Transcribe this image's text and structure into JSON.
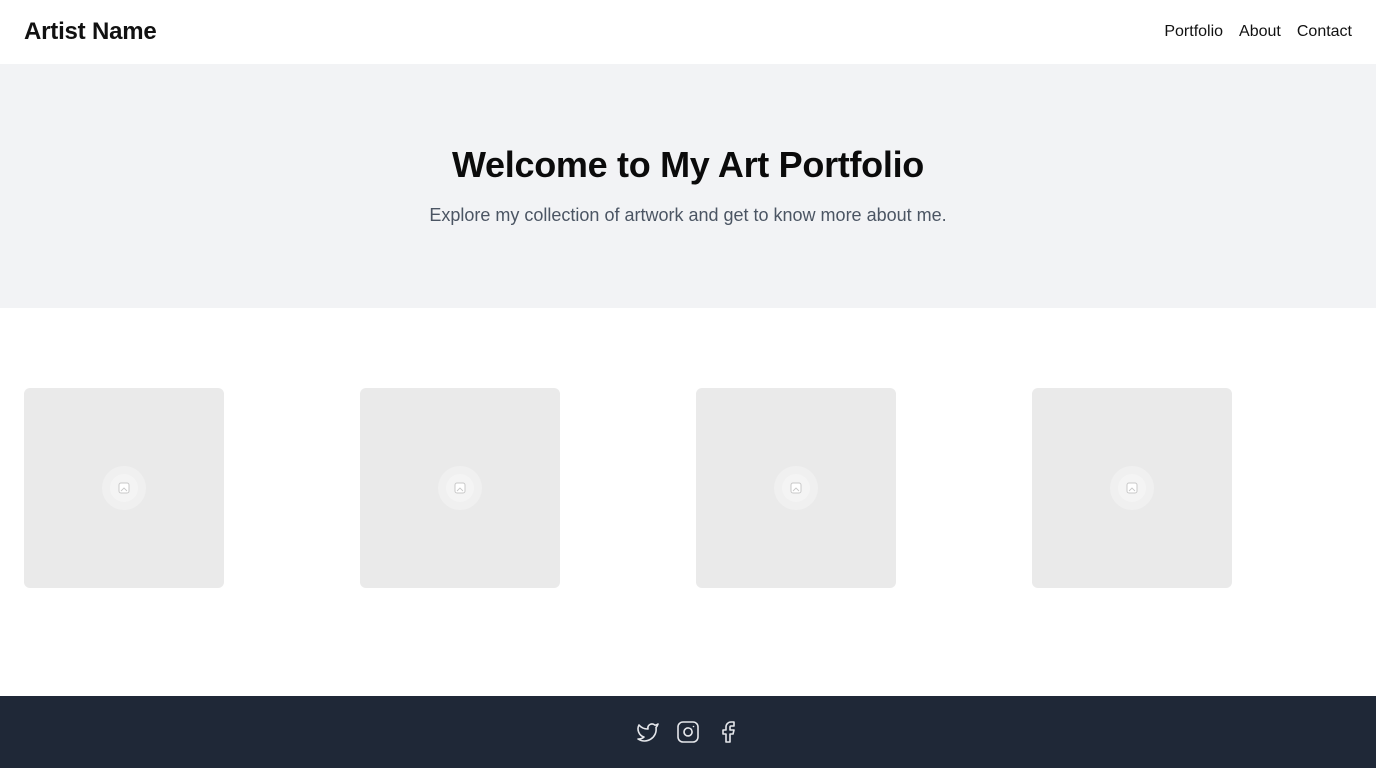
{
  "header": {
    "brand": "Artist Name",
    "nav": [
      {
        "label": "Portfolio"
      },
      {
        "label": "About"
      },
      {
        "label": "Contact"
      }
    ]
  },
  "hero": {
    "title": "Welcome to My Art Portfolio",
    "subtitle": "Explore my collection of artwork and get to know more about me."
  },
  "gallery": {
    "items": [
      {
        "icon": "image-placeholder-icon"
      },
      {
        "icon": "image-placeholder-icon"
      },
      {
        "icon": "image-placeholder-icon"
      },
      {
        "icon": "image-placeholder-icon"
      }
    ]
  },
  "footer": {
    "social": [
      {
        "icon": "twitter-icon"
      },
      {
        "icon": "instagram-icon"
      },
      {
        "icon": "facebook-icon"
      }
    ]
  },
  "colors": {
    "hero_bg": "#f2f3f5",
    "card_bg": "#eaeaea",
    "footer_bg": "#1f2837",
    "subtitle_text": "#4b5563",
    "icon_stroke": "#e5e7eb"
  }
}
